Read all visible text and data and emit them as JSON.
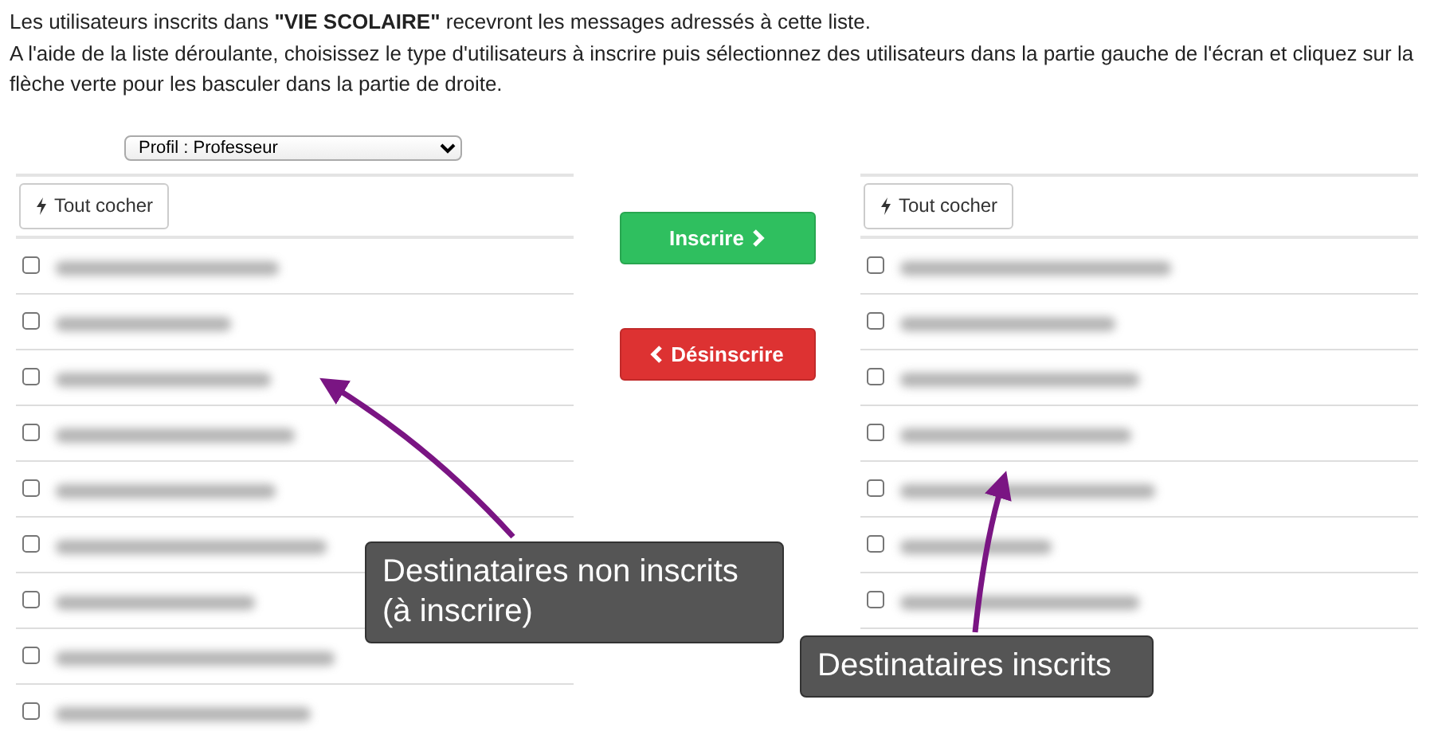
{
  "intro": [
    "Les utilisateurs inscrits dans **\"VIE SCOLAIRE\"** recevront les messages adressés à cette liste.",
    "A l'aide de la liste déroulante, choisissez le type d'utilisateurs à inscrire puis sélectionnez des utilisateurs dans la partie gauche de l'écran et cliquez sur la flèche verte pour les basculer dans la partie de droite."
  ],
  "profile_select": {
    "value": "Profil : Professeur"
  },
  "left_list": {
    "check_all": "Tout cocher",
    "rows": [
      {
        "checked": false
      },
      {
        "checked": false
      },
      {
        "checked": false
      },
      {
        "checked": false
      },
      {
        "checked": false
      },
      {
        "checked": false
      },
      {
        "checked": false
      },
      {
        "checked": false
      },
      {
        "checked": false
      }
    ]
  },
  "actions": [
    {
      "kind": "add",
      "label": "Inscrire"
    },
    {
      "kind": "remove",
      "label": "Désinscrire"
    }
  ],
  "right_list": {
    "check_all": "Tout cocher",
    "rows": [
      {
        "checked": false
      },
      {
        "checked": false
      },
      {
        "checked": false
      },
      {
        "checked": false
      },
      {
        "checked": false
      },
      {
        "checked": false
      },
      {
        "checked": false
      }
    ]
  },
  "annotations": [
    {
      "text": "Destinataires non inscrits\n(à inscrire)"
    },
    {
      "text": "Destinataires inscrits"
    }
  ]
}
